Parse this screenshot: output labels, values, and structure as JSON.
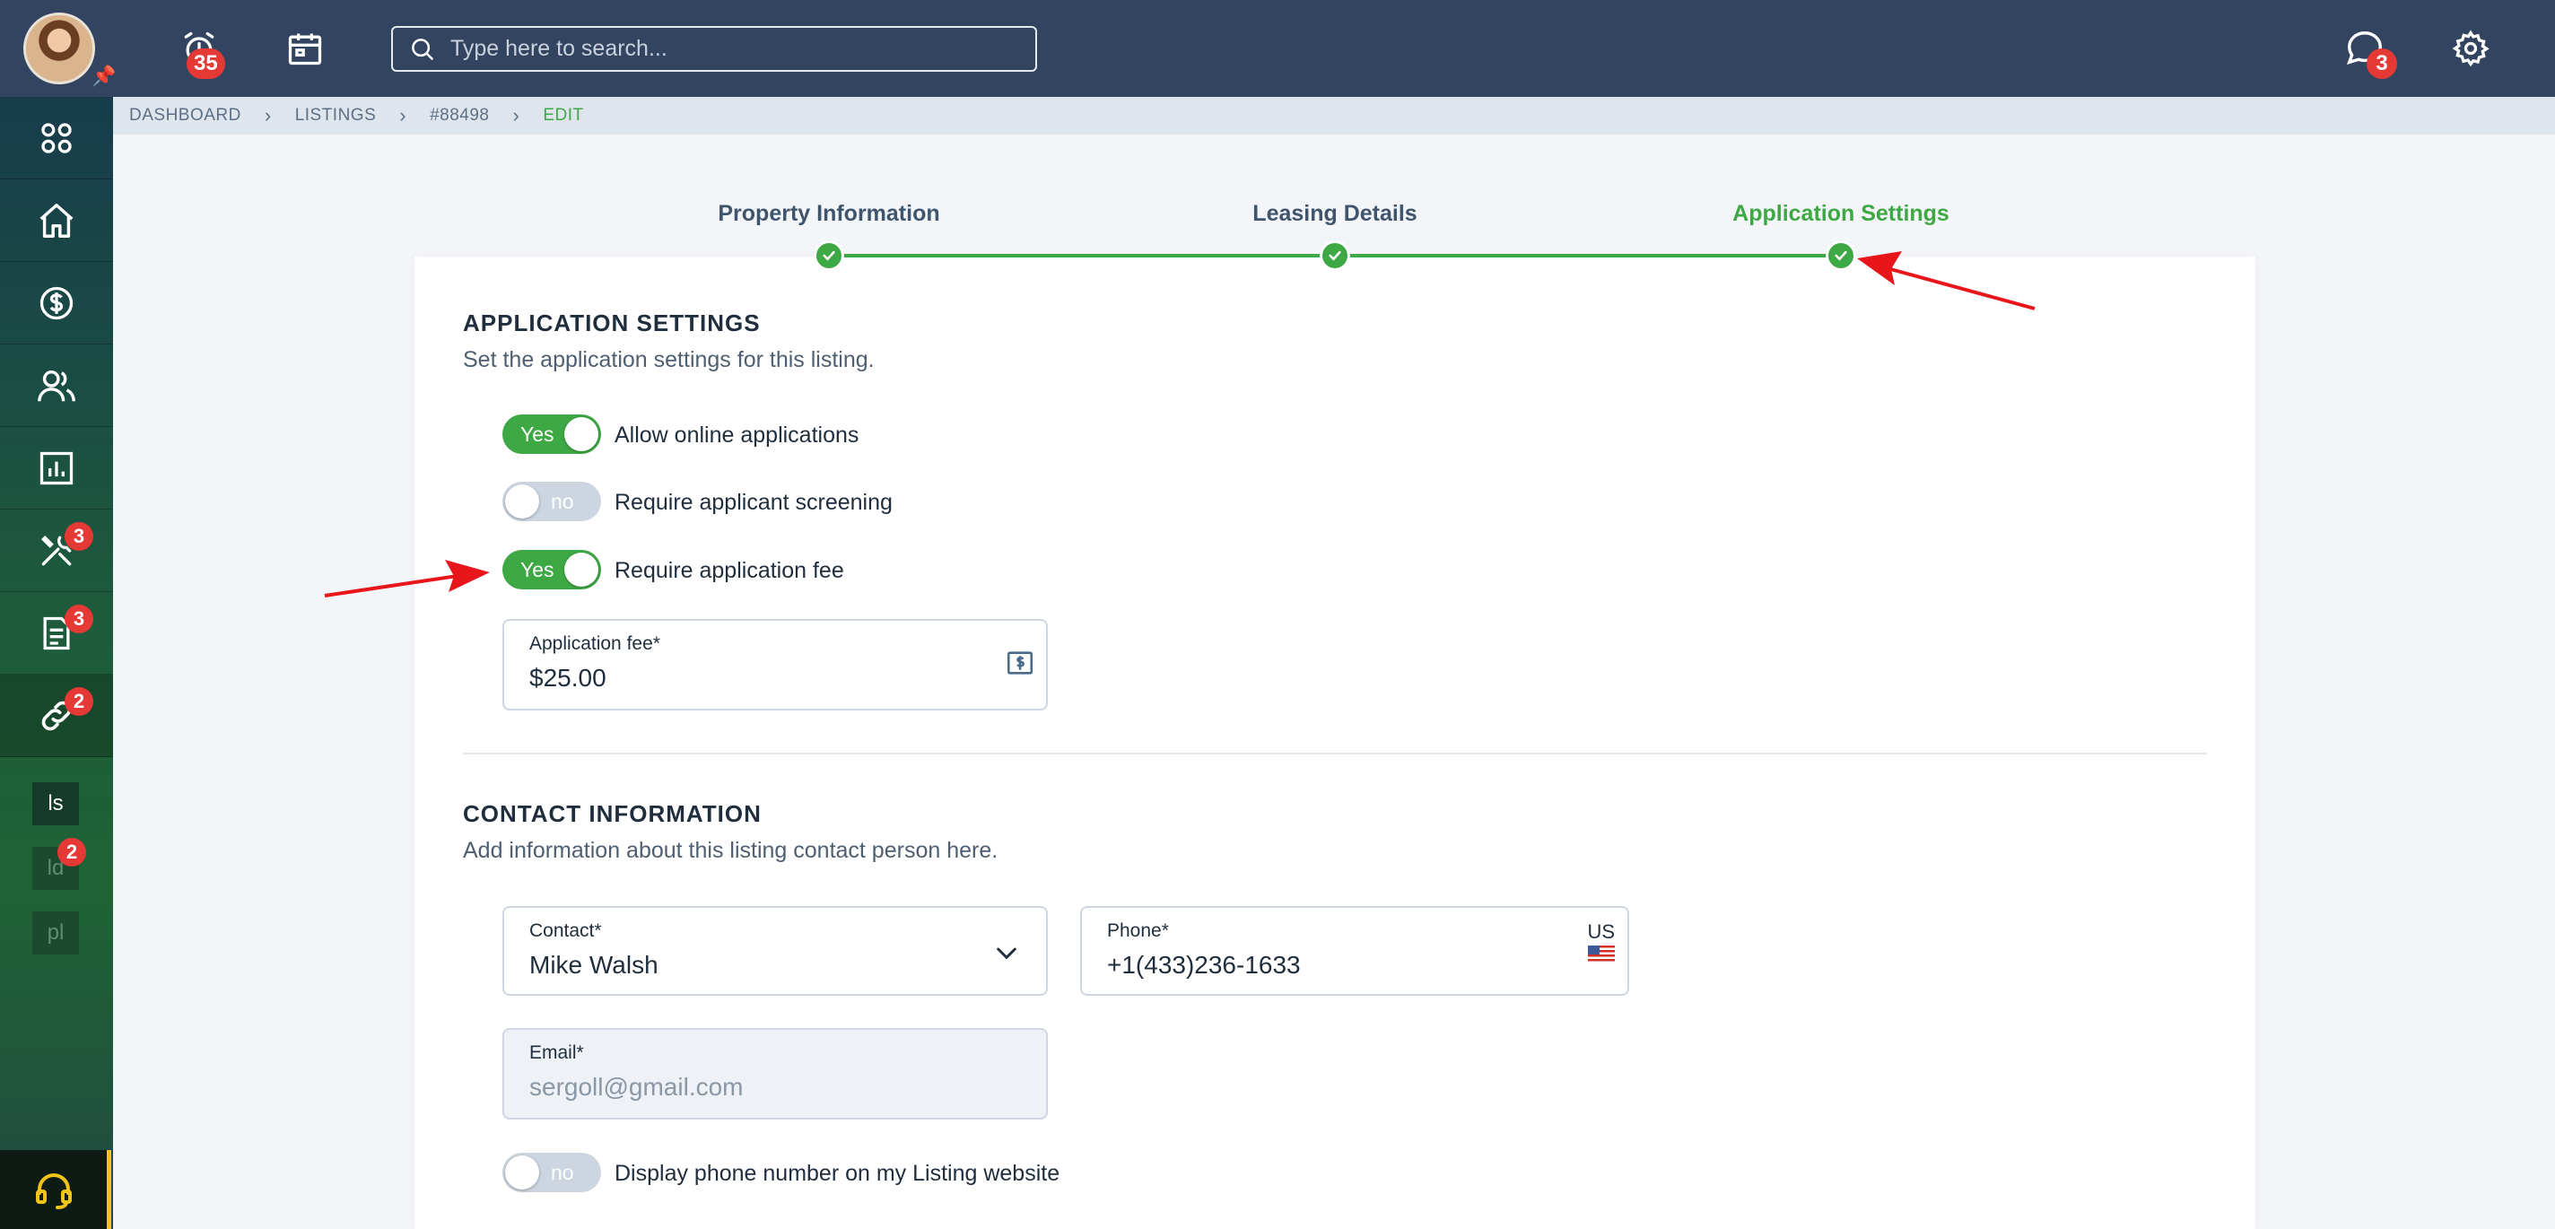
{
  "topbar": {
    "notifications_count": "35",
    "messages_count": "3",
    "search_placeholder": "Type here to search..."
  },
  "sidebar": {
    "badges": {
      "maintenance": "3",
      "documents": "3",
      "listings": "2",
      "mini_ld": "2"
    },
    "mini_items": [
      "ls",
      "ld",
      "pl"
    ]
  },
  "breadcrumb": [
    "DASHBOARD",
    "LISTINGS",
    "#88498",
    "EDIT"
  ],
  "stepper": {
    "steps": [
      "Property Information",
      "Leasing Details",
      "Application Settings"
    ],
    "active_index": 2
  },
  "application_settings": {
    "title": "APPLICATION SETTINGS",
    "subtitle": "Set the application settings for this listing.",
    "toggles": [
      {
        "state": "Yes",
        "label": "Allow online applications"
      },
      {
        "state": "no",
        "label": "Require applicant screening"
      },
      {
        "state": "Yes",
        "label": "Require application fee"
      }
    ],
    "fee_field": {
      "label": "Application fee*",
      "value": "$25.00"
    }
  },
  "contact_information": {
    "title": "CONTACT INFORMATION",
    "subtitle": "Add information about this listing contact person here.",
    "contact": {
      "label": "Contact*",
      "value": "Mike Walsh"
    },
    "phone": {
      "label": "Phone*",
      "value": "+1(433)236-1633",
      "country": "US"
    },
    "email": {
      "label": "Email*",
      "value": "sergoll@gmail.com"
    },
    "display_phone_toggle": {
      "state": "no",
      "label": "Display phone number on my Listing website"
    }
  },
  "colors": {
    "topbar": "#324460",
    "accent": "#3ea845",
    "badge": "#e53935",
    "annotation_arrow": "#e8151b"
  }
}
